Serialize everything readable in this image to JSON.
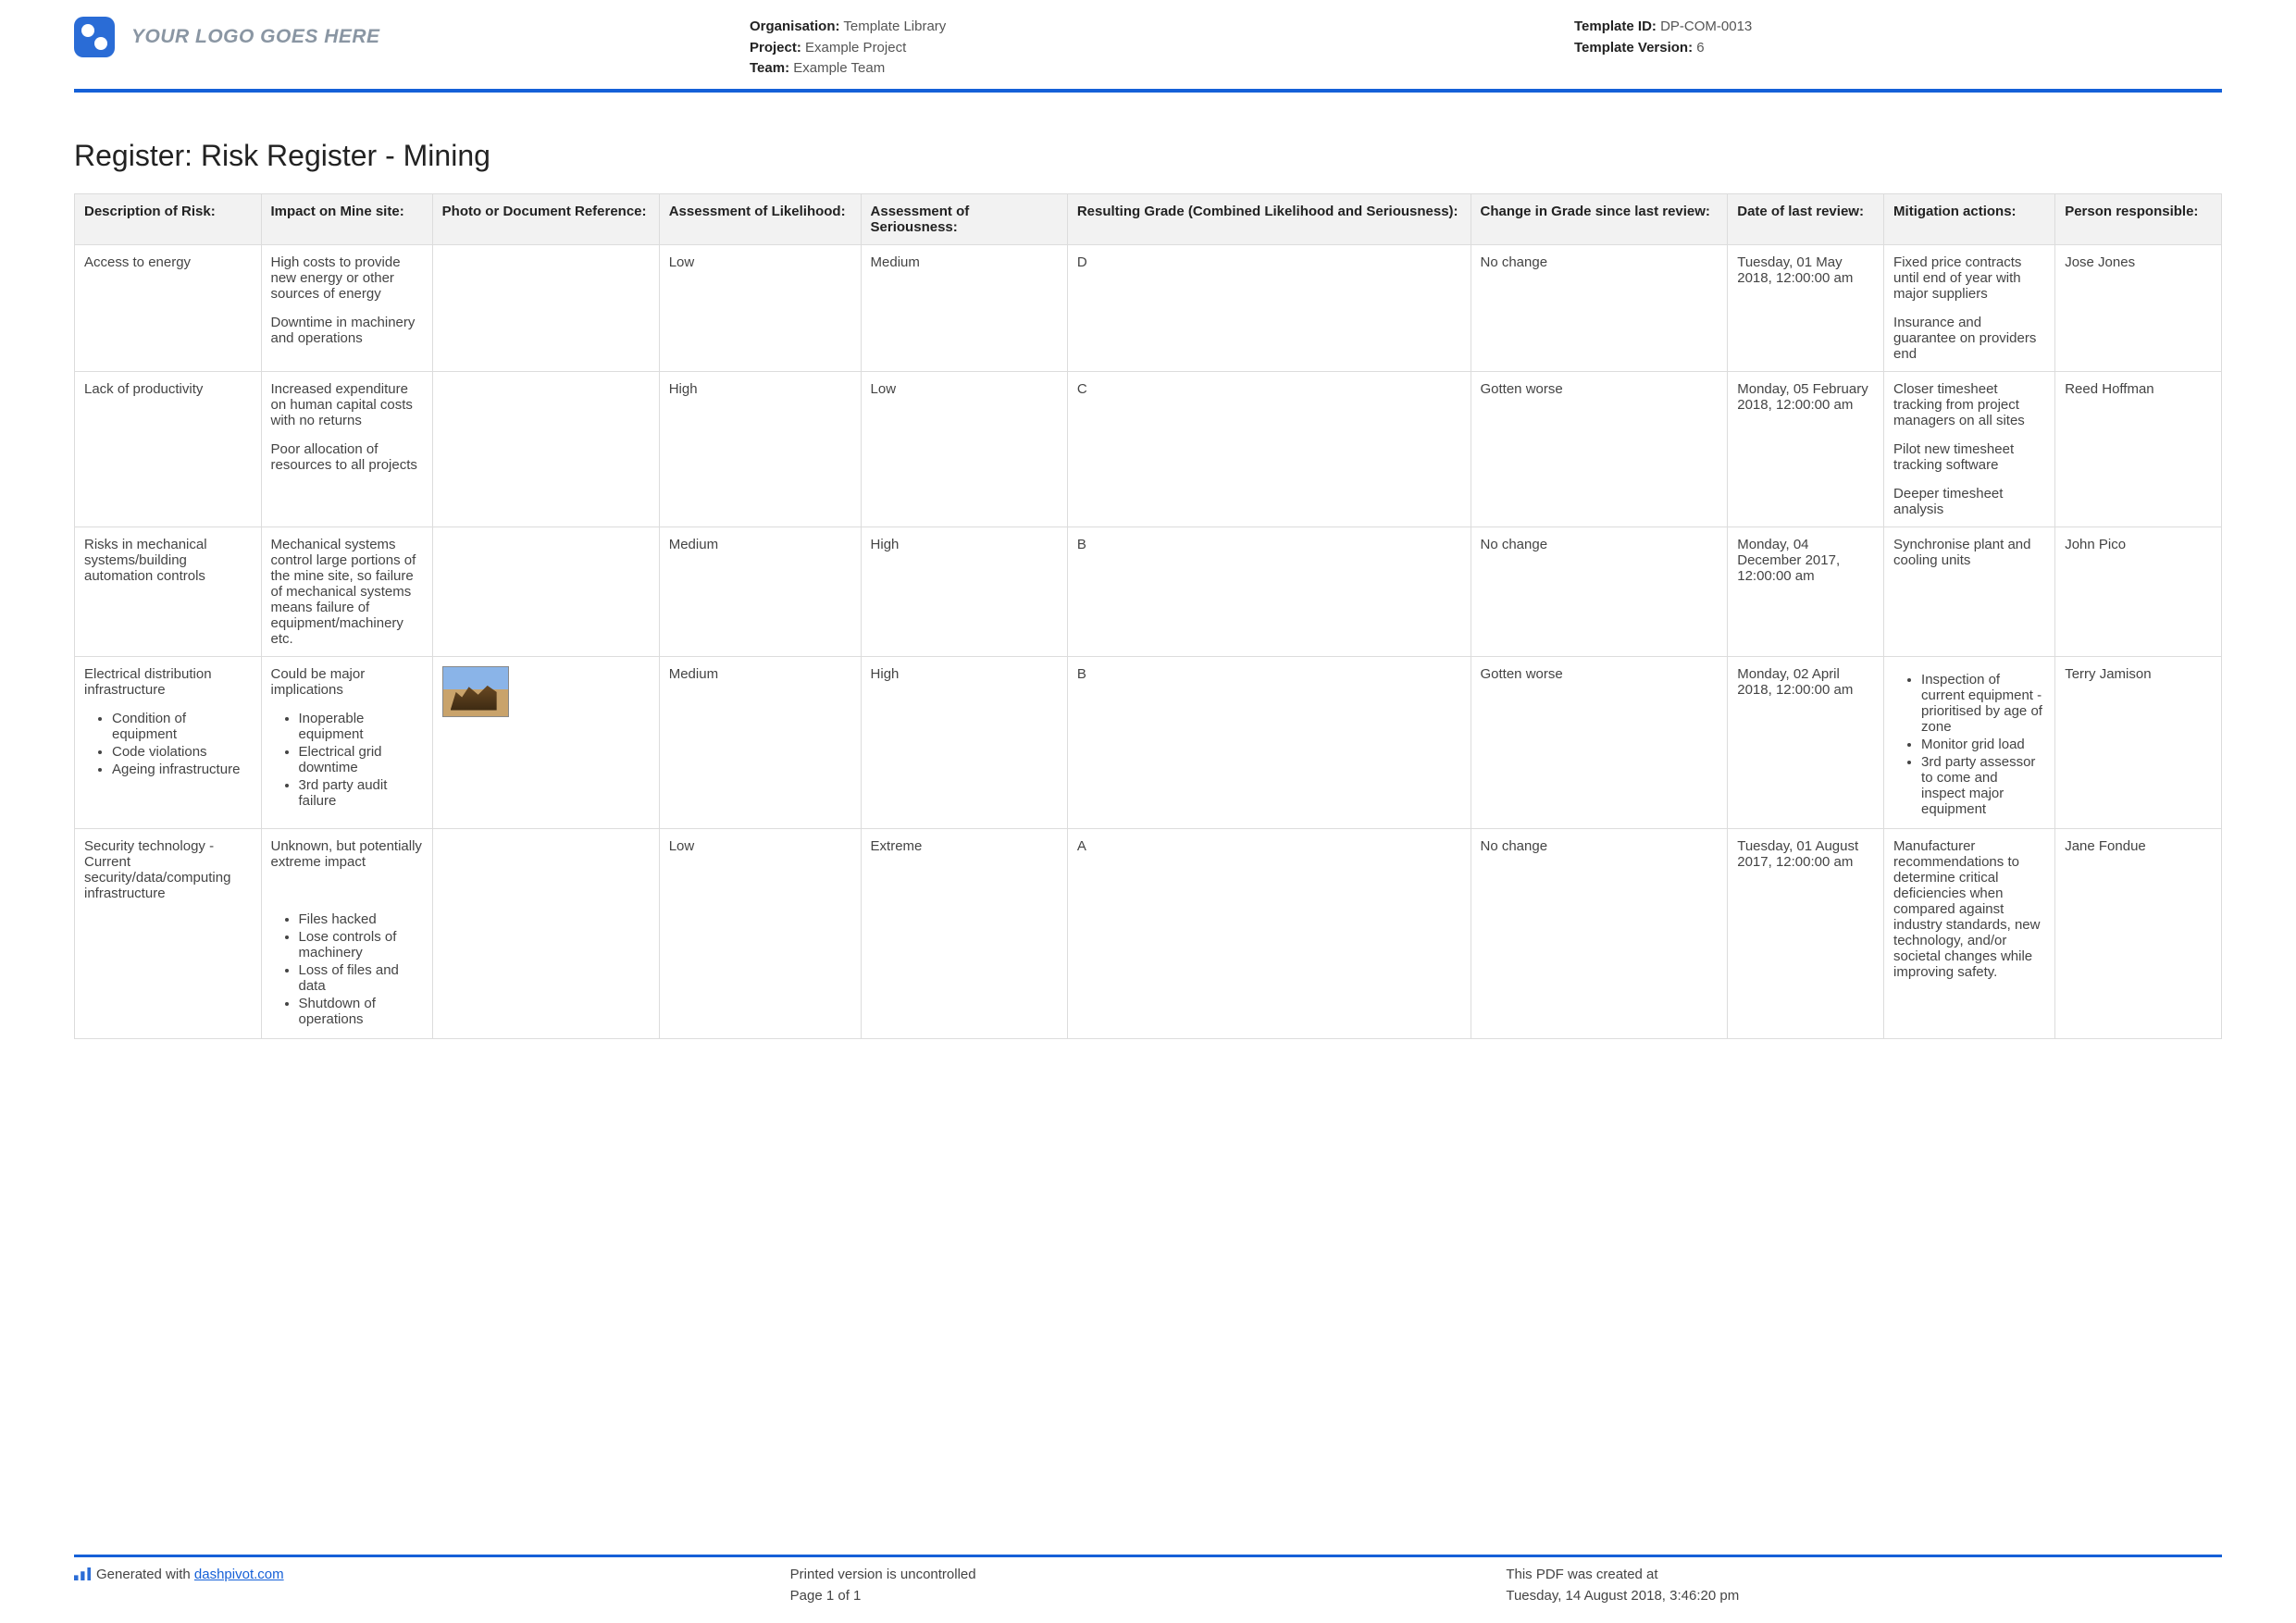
{
  "header": {
    "logo_text": "YOUR LOGO GOES HERE",
    "org_label": "Organisation:",
    "org_value": "Template Library",
    "project_label": "Project:",
    "project_value": "Example Project",
    "team_label": "Team:",
    "team_value": "Example Team",
    "tid_label": "Template ID:",
    "tid_value": "DP-COM-0013",
    "tver_label": "Template Version:",
    "tver_value": "6"
  },
  "title": "Register: Risk Register - Mining",
  "columns": [
    "Description of Risk:",
    "Impact on Mine site:",
    "Photo or Document Reference:",
    "Assessment of Likelihood:",
    "Assessment of Seriousness:",
    "Resulting Grade (Combined Likelihood and Seriousness):",
    "Change in Grade since last review:",
    "Date of last review:",
    "Mitigation actions:",
    "Person responsible:"
  ],
  "rows": [
    {
      "desc": {
        "text": "Access to energy"
      },
      "impact": {
        "paras": [
          "High costs to provide new energy or other sources of energy",
          "Downtime in machinery and operations"
        ]
      },
      "photo": "",
      "likelihood": "Low",
      "seriousness": "Medium",
      "grade": "D",
      "change": "No change",
      "date": "Tuesday, 01 May 2018, 12:00:00 am",
      "mitigation": {
        "paras": [
          "Fixed price contracts until end of year with major suppliers",
          "Insurance and guarantee on providers end"
        ]
      },
      "person": "Jose Jones"
    },
    {
      "desc": {
        "text": "Lack of productivity"
      },
      "impact": {
        "paras": [
          "Increased expenditure on human capital costs with no returns",
          "Poor allocation of resources to all projects"
        ]
      },
      "photo": "",
      "likelihood": "High",
      "seriousness": "Low",
      "grade": "C",
      "change": "Gotten worse",
      "date": "Monday, 05 February 2018, 12:00:00 am",
      "mitigation": {
        "paras": [
          "Closer timesheet tracking from project managers on all sites",
          "Pilot new timesheet tracking software",
          "Deeper timesheet analysis"
        ]
      },
      "person": "Reed Hoffman"
    },
    {
      "desc": {
        "text": "Risks in mechanical systems/building automation controls"
      },
      "impact": {
        "paras": [
          "Mechanical systems control large portions of the mine site, so failure of mechanical systems means failure of equipment/machinery etc."
        ]
      },
      "photo": "",
      "likelihood": "Medium",
      "seriousness": "High",
      "grade": "B",
      "change": "No change",
      "date": "Monday, 04 December 2017, 12:00:00 am",
      "mitigation": {
        "paras": [
          "Synchronise plant and cooling units"
        ]
      },
      "person": "John Pico"
    },
    {
      "desc": {
        "text": "Electrical distribution infrastructure",
        "bullets": [
          "Condition of equipment",
          "Code violations",
          "Ageing infrastructure"
        ]
      },
      "impact": {
        "text": "Could be major implications",
        "bullets": [
          "Inoperable equipment",
          "Electrical grid downtime",
          "3rd party audit failure"
        ]
      },
      "photo": "thumb",
      "likelihood": "Medium",
      "seriousness": "High",
      "grade": "B",
      "change": "Gotten worse",
      "date": "Monday, 02 April 2018, 12:00:00 am",
      "mitigation": {
        "bullets": [
          "Inspection of current equipment - prioritised by age of zone",
          "Monitor grid load",
          "3rd party assessor to come and inspect major equipment"
        ]
      },
      "person": "Terry Jamison"
    },
    {
      "desc": {
        "text": "Security technology - Current security/data/computing infrastructure"
      },
      "impact": {
        "text": "Unknown, but potentially extreme impact",
        "gap": true,
        "bullets": [
          "Files hacked",
          "Lose controls of machinery",
          "Loss of files and data",
          "Shutdown of operations"
        ]
      },
      "photo": "",
      "likelihood": "Low",
      "seriousness": "Extreme",
      "grade": "A",
      "change": "No change",
      "date": "Tuesday, 01 August 2017, 12:00:00 am",
      "mitigation": {
        "paras": [
          "Manufacturer recommendations to determine critical deficiencies when compared against industry standards, new technology, and/or societal changes while improving safety."
        ]
      },
      "person": "Jane Fondue"
    }
  ],
  "footer": {
    "generated_prefix": "Generated with ",
    "generated_link": "dashpivot.com",
    "uncontrolled": "Printed version is uncontrolled",
    "page_of": "Page 1 of 1",
    "created_at_lbl": "This PDF was created at",
    "created_at_val": "Tuesday, 14 August 2018, 3:46:20 pm"
  }
}
